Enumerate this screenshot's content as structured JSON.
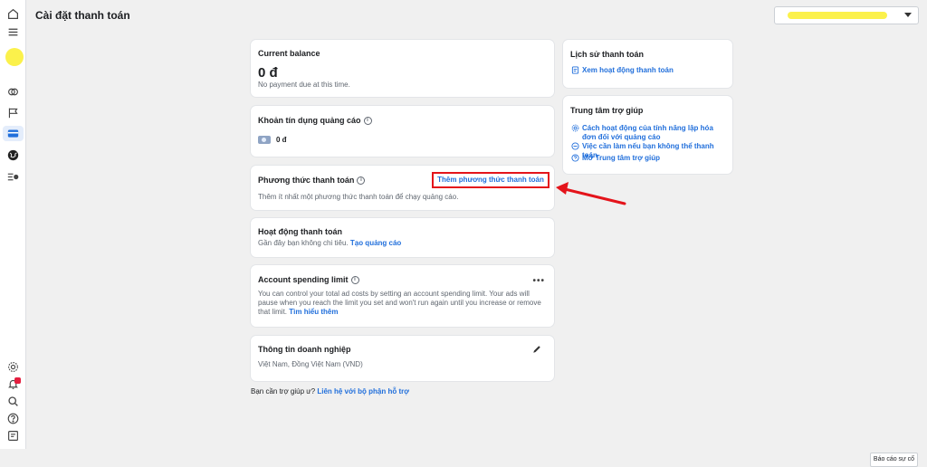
{
  "page_title": "Cài đặt thanh toán",
  "account_selector": {
    "value": "",
    "name_color": "#fbf14b"
  },
  "sidebar": {
    "icons": [
      "home-icon",
      "menu-icon",
      "avatar",
      "stack-icon",
      "flag-icon",
      "card-icon",
      "globe-icon",
      "list-gear-icon",
      "gear-icon",
      "bell-icon",
      "search-icon",
      "help-icon",
      "report-icon"
    ],
    "notification_count": "1"
  },
  "cards": {
    "balance": {
      "title": "Current balance",
      "amount": "0 đ",
      "note": "No payment due at this time."
    },
    "ad_credit": {
      "title": "Khoản tín dụng quảng cáo",
      "value": "0 đ"
    },
    "payment_method": {
      "title": "Phương thức thanh toán",
      "add_button": "Thêm phương thức thanh toán",
      "note": "Thêm ít nhất một phương thức thanh toán để chạy quảng cáo."
    },
    "payment_activity": {
      "title": "Hoạt động thanh toán",
      "note": "Gần đây bạn không chi tiêu.",
      "link": "Tạo quảng cáo"
    },
    "spending_limit": {
      "title": "Account spending limit",
      "description": "You can control your total ad costs by setting an account spending limit. Your ads will pause when you reach the limit you set and won't run again until you increase or remove that limit.",
      "link": "Tìm hiểu thêm"
    },
    "business_info": {
      "title": "Thông tin doanh nghiệp",
      "value": "Việt Nam, Đồng Việt Nam (VND)"
    }
  },
  "help": {
    "question": "Bạn cần trợ giúp ư?",
    "link": "Liên hệ với bộ phận hỗ trợ"
  },
  "right_panel": {
    "history": {
      "title": "Lịch sử thanh toán",
      "link": "Xem hoạt động thanh toán"
    },
    "help_center": {
      "title": "Trung tâm trợ giúp",
      "links": [
        {
          "icon": "gear-icon",
          "text": "Cách hoạt động của tính năng lập hóa đơn đối với quảng cáo"
        },
        {
          "icon": "minus-circle-icon",
          "text": "Việc cần làm nếu bạn không thể thanh toán"
        },
        {
          "icon": "question-circle-icon",
          "text": "Mở Trung tâm trợ giúp"
        }
      ]
    }
  },
  "report_button": "Báo cáo sự cố",
  "colors": {
    "accent": "#216fdb",
    "highlight": "#e4141b",
    "background": "#f0f0f0"
  }
}
